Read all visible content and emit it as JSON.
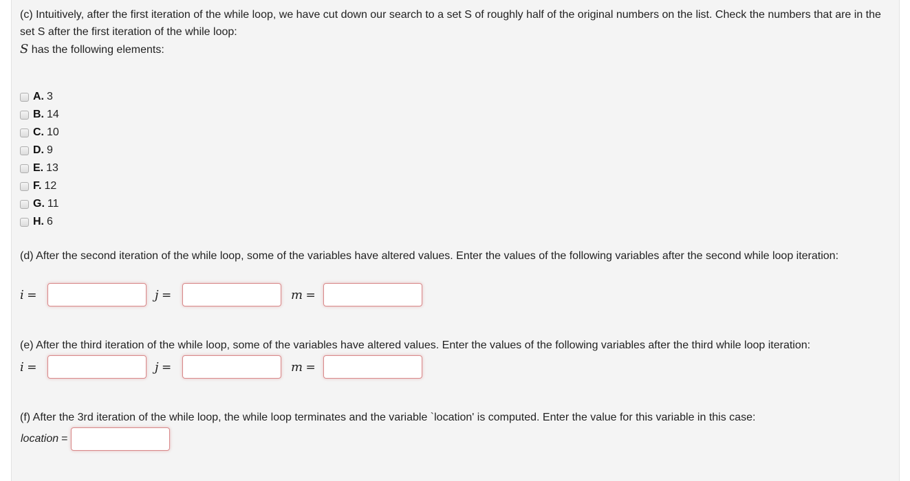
{
  "part_c": {
    "prompt": "(c) Intuitively, after the first iteration of the while loop, we have cut down our search to a set S of roughly half of the original numbers on the list. Check the numbers that are in the set S after the first iteration of the while loop:",
    "set_symbol": "S",
    "set_text": " has the following elements:",
    "choices": [
      {
        "letter": "A.",
        "value": "3",
        "checked": false
      },
      {
        "letter": "B.",
        "value": "14",
        "checked": false
      },
      {
        "letter": "C.",
        "value": "10",
        "checked": false
      },
      {
        "letter": "D.",
        "value": "9",
        "checked": false
      },
      {
        "letter": "E.",
        "value": "13",
        "checked": false
      },
      {
        "letter": "F.",
        "value": "12",
        "checked": false
      },
      {
        "letter": "G.",
        "value": "11",
        "checked": false
      },
      {
        "letter": "H.",
        "value": "6",
        "checked": false
      }
    ]
  },
  "part_d": {
    "prompt": "(d) After the second iteration of the while loop, some of the variables have altered values. Enter the values of the following variables after the second while loop iteration:",
    "fields": [
      {
        "var": "i",
        "eq": "=",
        "value": ""
      },
      {
        "var": "j",
        "eq": "=",
        "value": ""
      },
      {
        "var": "m",
        "eq": "=",
        "value": ""
      }
    ]
  },
  "part_e": {
    "prompt": "(e) After the third iteration of the while loop, some of the variables have altered values. Enter the values of the following variables after the third while loop iteration:",
    "fields": [
      {
        "var": "i",
        "eq": "=",
        "value": ""
      },
      {
        "var": "j",
        "eq": "=",
        "value": ""
      },
      {
        "var": "m",
        "eq": "=",
        "value": ""
      }
    ]
  },
  "part_f": {
    "prompt": "(f) After the 3rd iteration of the while loop, the while loop terminates and the variable `location' is computed. Enter the value for this variable in this case:",
    "label": "location",
    "eq": "=",
    "value": ""
  }
}
